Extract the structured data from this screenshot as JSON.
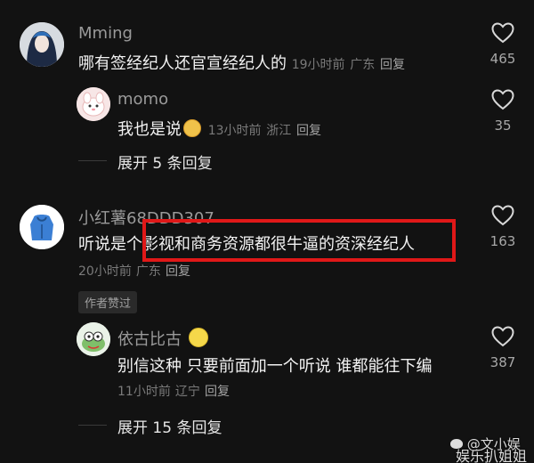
{
  "comments": [
    {
      "username": "Mming",
      "text": "哪有签经纪人还官宣经纪人的",
      "time": "19小时前",
      "location": "广东",
      "reply_label": "回复",
      "likes": "465"
    },
    {
      "username": "momo",
      "text_before_emoji": "我也是说",
      "time": "13小时前",
      "location": "浙江",
      "reply_label": "回复",
      "likes": "35"
    },
    {
      "username": "小红薯68DDD307",
      "text": "听说是个影视和商务资源都很牛逼的资深经纪人",
      "time": "20小时前",
      "location": "广东",
      "reply_label": "回复",
      "likes": "163",
      "author_badge": "作者赞过"
    },
    {
      "username": "依古比古",
      "text": "别信这种 只要前面加一个听说 谁都能往下编",
      "time": "11小时前",
      "location": "辽宁",
      "reply_label": "回复",
      "likes": "387"
    }
  ],
  "expand_replies": [
    {
      "label": "展开 5 条回复"
    },
    {
      "label": "展开 15 条回复"
    }
  ],
  "watermark": {
    "line1": "@文小娱",
    "line2": "娱乐扒姐姐"
  },
  "colors": {
    "background": "#121212",
    "highlight": "#e01818"
  }
}
